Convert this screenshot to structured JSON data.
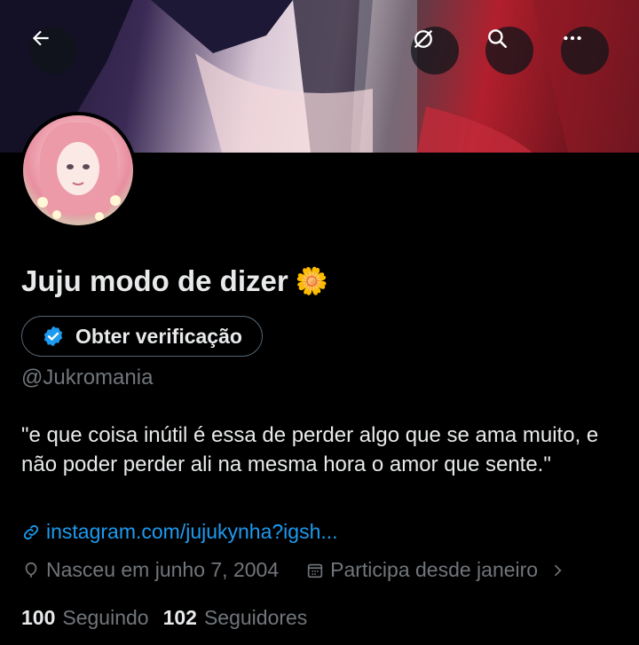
{
  "header": {
    "back_icon": "arrow-left-icon",
    "grok_icon": "grok-icon",
    "search_icon": "search-icon",
    "more_icon": "more-horizontal-icon"
  },
  "profile": {
    "display_name": "Juju modo de dizer",
    "name_emoji": "🌼",
    "verify_button_label": "Obter verificação",
    "handle": "@Jukromania",
    "bio": "\"e que coisa inútil é essa de perder algo que se ama muito, e não poder perder ali na mesma hora o amor que sente.\"",
    "link": "instagram.com/jujukynha?igsh...",
    "birthday": "Nasceu em junho 7, 2004",
    "joined": "Participa desde janeiro",
    "following_count": "100",
    "following_label": "Seguindo",
    "followers_count": "102",
    "followers_label": "Seguidores"
  },
  "colors": {
    "background": "#000000",
    "text_primary": "#e7e9ea",
    "text_secondary": "#71767b",
    "link": "#1d9bf0",
    "border": "#536471"
  }
}
